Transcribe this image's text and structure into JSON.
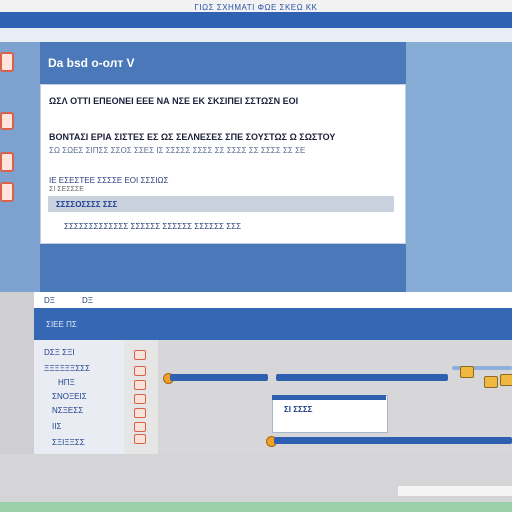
{
  "top": {
    "title": "ΓΙΩΣ ΣΧΗΜΑΤΙ ΦΩΕ ΣΚΕΩ ΚΚ"
  },
  "window": {
    "title": "Dа bsd о-олт V"
  },
  "dialog": {
    "line1": "ΩΣΛ ΟΤΤΙ ΕΠΕΟΝΕΙ ΕΕΕ ΝΑ ΝΣΕ ΕΚ ΣΚΣΙΠΕΙ ΣΣΤΩΣΝ ΕΟΙ",
    "line2": "ΒΟΝΤΑΣΙ ΕΡΙΑ ΣΙΣΤΕΣ ΕΣ ΩΣ ΣΕΛΝΕΣΕΣ ΣΠΕ ΣΟΥΣΤΩΣ Ω ΣΩΣΤΟΥ",
    "line3": "ΣΩ ΣΩΕΣ ΣΙΠΣΣ ΣΣΟΣ ΣΣΕΣ ΙΣ ΣΣΣΣΣ ΣΣΣΣ ΣΣ ΣΣΣΣ ΣΣ ΣΣΣΣ ΣΣ ΣΕ",
    "line4": "ΙΕ ΕΣΕΣΤΕΕ   ΣΣΣΣΕ ΕΟΙ ΣΣΣΙΩΣ",
    "line5": "ΣΙ ΣΕΣΣΣΕ",
    "field_value": "ΣΣΣΣΟΣΣΣΣ ΣΣΣ",
    "line6": "ΣΣΣΣΣΣΣΣΣΣΣΣΣ ΣΣΣΣΣΣ ΣΣΣΣΣΣ ΣΣΣΣΣΣ ΣΣΣ"
  },
  "tabs": [
    "DΞ",
    "DΞ"
  ],
  "bluebar": {
    "text": "ΣΙΕΕ ΠΣ"
  },
  "sidebar": {
    "items": [
      "DΣΞ ΣΞΙ",
      "ΞΞΞΞΞΞΣΣΣ",
      "ΗΠΞ",
      "ΣΝΟΞΕΙΣ",
      "ΝΣΞΕΣΣ",
      "ΙΙΣ",
      "ΣΞΙΞΞΣΣ"
    ]
  },
  "content": {
    "frame_label": "ΣΙ ΣΣΣΣ"
  },
  "colors": {
    "accent": "#2f62b3",
    "panel": "#4a78b8",
    "warning": "#d9624b",
    "knob": "#f0a028"
  },
  "icons": [
    "close-icon",
    "folder-icon",
    "settings-icon",
    "warning-icon"
  ]
}
